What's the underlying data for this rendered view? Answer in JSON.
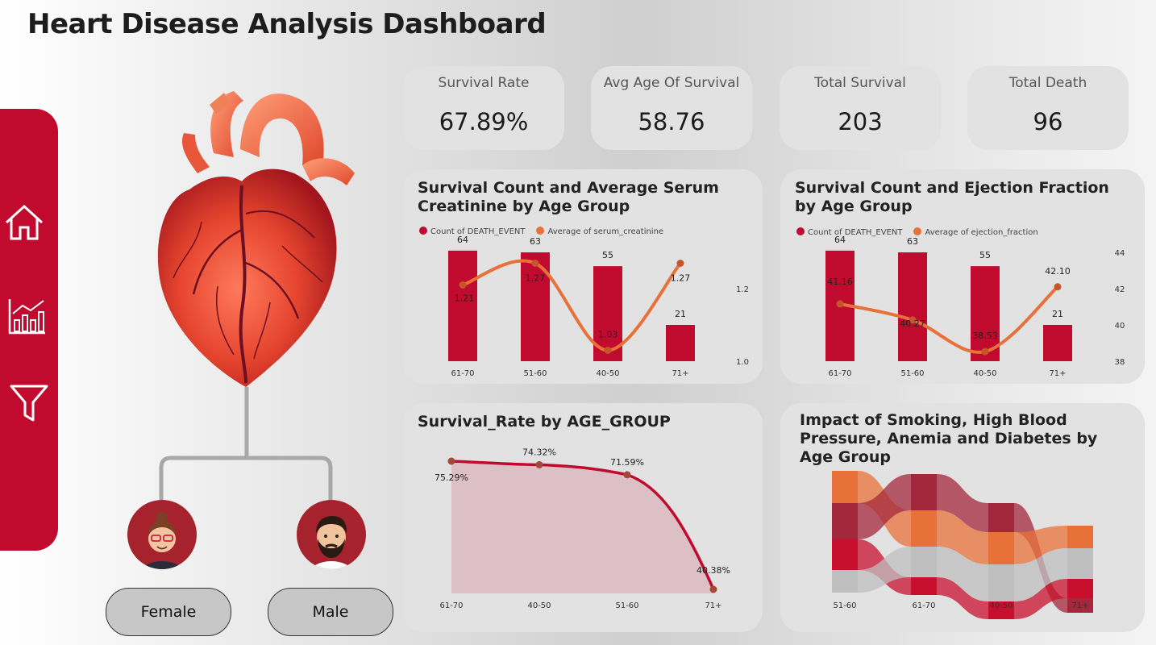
{
  "title": "Heart Disease Analysis Dashboard",
  "nav": [
    {
      "icon": "home-icon"
    },
    {
      "icon": "chart-icon"
    },
    {
      "icon": "filter-icon"
    }
  ],
  "kpis": [
    {
      "label": "Survival Rate",
      "value": "67.89%"
    },
    {
      "label": "Avg Age Of Survival",
      "value": "58.76"
    },
    {
      "label": "Total Survival",
      "value": "203"
    },
    {
      "label": "Total Death",
      "value": "96"
    }
  ],
  "gender": {
    "female": "Female",
    "male": "Male"
  },
  "colors": {
    "bar": "#c00b2e",
    "line": "#e8713a",
    "area": "#dcc0c6",
    "brand": "#c00b2e"
  },
  "chart_data": [
    {
      "type": "bar",
      "title": "Survival Count and Average Serum Creatinine by Age Group",
      "categories": [
        "61-70",
        "51-60",
        "40-50",
        "71+"
      ],
      "series": [
        {
          "name": "Count of DEATH_EVENT",
          "values": [
            64,
            63,
            55,
            21
          ],
          "labels": [
            "64",
            "63",
            "55",
            "21"
          ]
        },
        {
          "name": "Average of serum_creatinine",
          "type": "line",
          "axis": "secondary",
          "values": [
            1.21,
            1.27,
            1.03,
            1.27
          ],
          "labels": [
            "1.21",
            "1.27",
            "1.03",
            "1.27"
          ]
        }
      ],
      "ylim_secondary": [
        1.0,
        1.2
      ],
      "secondary_ticks": [
        "1.0",
        "1.2"
      ]
    },
    {
      "type": "bar",
      "title": "Survival Count and Ejection Fraction by Age Group",
      "categories": [
        "61-70",
        "51-60",
        "40-50",
        "71+"
      ],
      "series": [
        {
          "name": "Count of DEATH_EVENT",
          "values": [
            64,
            63,
            55,
            21
          ],
          "labels": [
            "64",
            "63",
            "55",
            "21"
          ]
        },
        {
          "name": "Average of ejection_fraction",
          "type": "line",
          "axis": "secondary",
          "values": [
            41.16,
            40.27,
            38.53,
            42.1
          ],
          "labels": [
            "41.16",
            "40.27",
            "38.53",
            "42.10"
          ]
        }
      ],
      "ylim_secondary": [
        38,
        44
      ],
      "secondary_ticks": [
        "38",
        "40",
        "42",
        "44"
      ]
    },
    {
      "type": "area",
      "title": "Survival_Rate by AGE_GROUP",
      "categories": [
        "61-70",
        "40-50",
        "51-60",
        "71+"
      ],
      "values": [
        75.29,
        74.32,
        71.59,
        40.38
      ],
      "labels": [
        "75.29%",
        "74.32%",
        "71.59%",
        "40.38%"
      ]
    },
    {
      "type": "ribbon",
      "title": "Impact of Smoking, High Blood Pressure, Anemia and Diabetes by Age Group",
      "categories": [
        "51-60",
        "61-70",
        "40-50",
        "71+"
      ],
      "stacks": [
        [
          "#e8713a",
          "#a3283c",
          "#c8102e",
          "#bfbfbf"
        ],
        [
          "#a3283c",
          "#e8713a",
          "#bfbfbf",
          "#c8102e"
        ],
        [
          "#a3283c",
          "#e8713a",
          "#bfbfbf",
          "#c8102e"
        ],
        [
          "#e8713a",
          "#bfbfbf",
          "#c8102e",
          "#a3283c"
        ]
      ]
    }
  ]
}
